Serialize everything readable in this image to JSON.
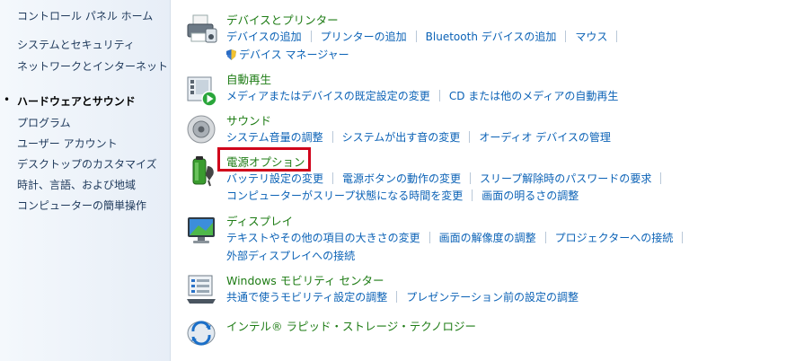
{
  "sidebar": {
    "home": "コントロール パネル ホーム",
    "current_marker": "•",
    "items": [
      {
        "label": "システムとセキュリティ"
      },
      {
        "label": "ネットワークとインターネット"
      },
      {
        "label": "ハードウェアとサウンド"
      },
      {
        "label": "プログラム"
      },
      {
        "label": "ユーザー アカウント"
      },
      {
        "label": "デスクトップのカスタマイズ"
      },
      {
        "label": "時計、言語、および地域"
      },
      {
        "label": "コンピューターの簡単操作"
      }
    ]
  },
  "categories": [
    {
      "icon": "printer-icon",
      "title": "デバイスとプリンター",
      "links": [
        "デバイスの追加",
        "プリンターの追加",
        "Bluetooth デバイスの追加",
        "マウス",
        "デバイス マネージャー"
      ]
    },
    {
      "icon": "autoplay-icon",
      "title": "自動再生",
      "links": [
        "メディアまたはデバイスの既定設定の変更",
        "CD または他のメディアの自動再生"
      ]
    },
    {
      "icon": "speaker-icon",
      "title": "サウンド",
      "links": [
        "システム音量の調整",
        "システムが出す音の変更",
        "オーディオ デバイスの管理"
      ]
    },
    {
      "icon": "battery-icon",
      "title": "電源オプション",
      "links": [
        "バッテリ設定の変更",
        "電源ボタンの動作の変更",
        "スリープ解除時のパスワードの要求",
        "コンピューターがスリープ状態になる時間を変更",
        "画面の明るさの調整"
      ]
    },
    {
      "icon": "display-icon",
      "title": "ディスプレイ",
      "links": [
        "テキストやその他の項目の大きさの変更",
        "画面の解像度の調整",
        "プロジェクターへの接続",
        "外部ディスプレイへの接続"
      ]
    },
    {
      "icon": "mobility-center-icon",
      "title": "Windows モビリティ センター",
      "links": [
        "共通で使うモビリティ設定の調整",
        "プレゼンテーション前の設定の調整"
      ]
    },
    {
      "icon": "intel-rst-icon",
      "title": "インテル® ラピッド・ストレージ・テクノロジー",
      "links": []
    }
  ],
  "colors": {
    "link": "#0b62b6",
    "category_title": "#1e7c15",
    "highlight": "#d0021b",
    "sidebar_text": "#1e395b"
  }
}
